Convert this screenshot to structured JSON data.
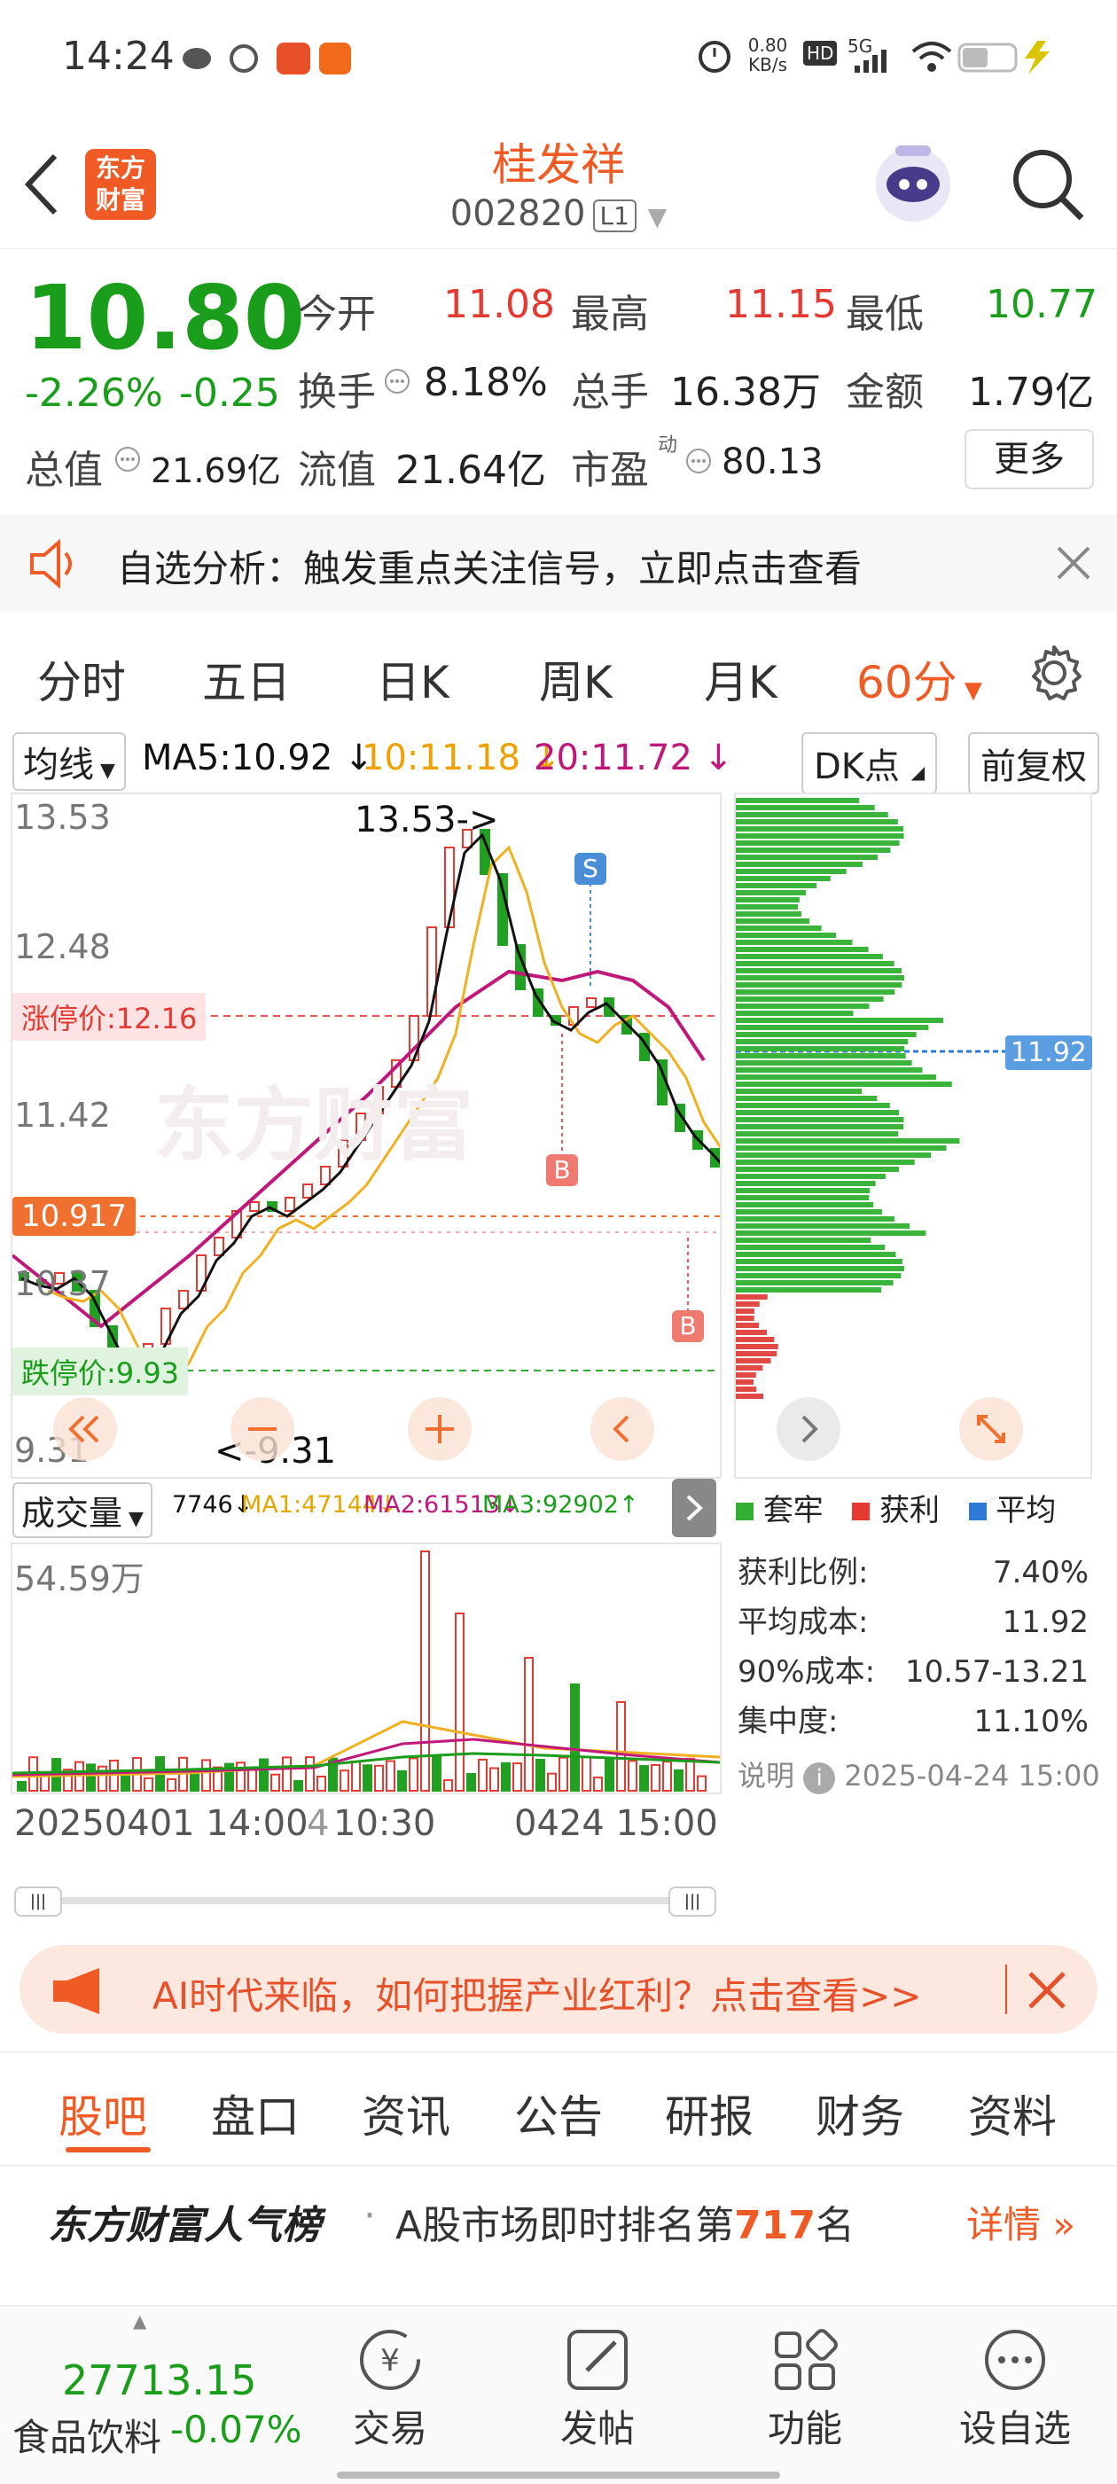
{
  "status_bar": {
    "time": "14:24",
    "net_speed_value": "0.80",
    "net_speed_unit": "KB/s",
    "hd": "HD",
    "signal": "5G"
  },
  "header": {
    "title": "桂发祥",
    "code": "002820",
    "level": "L1",
    "logo_line1": "东方",
    "logo_line2": "财富"
  },
  "quote": {
    "price": "10.80",
    "change_pct": "-2.26%",
    "change": "-0.25",
    "open_label": "今开",
    "open": "11.08",
    "high_label": "最高",
    "high": "11.15",
    "low_label": "最低",
    "low": "10.77",
    "turnover_label": "换手",
    "turnover": "8.18%",
    "volume_label": "总手",
    "volume": "16.38万",
    "amount_label": "金额",
    "amount": "1.79亿",
    "mktcap_label": "总值",
    "mktcap": "21.69亿",
    "float_label": "流值",
    "float": "21.64亿",
    "pe_label": "市盈",
    "pe_sup": "动",
    "pe": "80.13",
    "more_label": "更多"
  },
  "alert_banner": {
    "text": "自选分析：触发重点关注信号，立即点击查看"
  },
  "period_tabs": [
    "分时",
    "五日",
    "日K",
    "周K",
    "月K",
    "60分"
  ],
  "active_period": "60分",
  "chart_toolbar": {
    "indicator": "均线",
    "ma5": "MA5:10.92",
    "ma10": "10:11.18",
    "ma20": "20:11.72",
    "dk": "DK点",
    "adjust": "前复权"
  },
  "kline": {
    "price_labels": [
      "13.53",
      "12.48",
      "11.42",
      "10.37",
      "9.31"
    ],
    "limit_up": "涨停价:12.16",
    "limit_down": "跌停价:9.93",
    "current_marker": "10.917",
    "high_note": "13.53->",
    "low_note": "<-9.31",
    "signals": [
      "S",
      "B",
      "B"
    ],
    "watermark": "东方财富"
  },
  "chip_distribution": {
    "avg_cost_marker": "11.92",
    "legend": [
      {
        "label": "套牢",
        "color": "#33b033"
      },
      {
        "label": "获利",
        "color": "#e53a32"
      },
      {
        "label": "平均",
        "color": "#2e7ad6"
      }
    ],
    "stats": [
      {
        "label": "获利比例:",
        "value": "7.40%"
      },
      {
        "label": "平均成本:",
        "value": "11.92"
      },
      {
        "label": "90%成本:",
        "value": "10.57-13.21"
      },
      {
        "label": "集中度:",
        "value": "11.10%"
      }
    ],
    "note_label": "说明",
    "note_time": "2025-04-24 15:00"
  },
  "volume": {
    "selector": "成交量",
    "vol": "7746",
    "ma1": "MA1:47144",
    "ma2": "MA2:61513",
    "ma3": "MA3:92902",
    "max_label": "54.59万",
    "time_start": "20250401 14:00",
    "time_mid1": "4",
    "time_mid2": "10:30",
    "time_end": "0424 15:00"
  },
  "promo": {
    "text": "AI时代来临，如何把握产业红利？点击查看>>"
  },
  "feed_tabs": [
    "股吧",
    "盘口",
    "资讯",
    "公告",
    "研报",
    "财务",
    "资料"
  ],
  "active_feed_tab": "股吧",
  "popularity": {
    "brand": "东方财富人气榜",
    "text_prefix": "A股市场即时排名第",
    "rank": "717",
    "text_suffix": "名",
    "detail": "详情"
  },
  "bottom_nav": {
    "index_value": "27713.15",
    "index_name": "食品饮料",
    "index_change": "-0.07%",
    "items": [
      {
        "label": "交易",
        "icon": "yen-icon"
      },
      {
        "label": "发帖",
        "icon": "edit-icon"
      },
      {
        "label": "功能",
        "icon": "grid-icon"
      },
      {
        "label": "设自选",
        "icon": "more-icon"
      }
    ]
  },
  "colors": {
    "up": "#e53a32",
    "down": "#1a9d1a",
    "brand": "#f05a24",
    "ma5": "#111111",
    "ma10": "#f0a000",
    "ma20": "#c0187a"
  }
}
